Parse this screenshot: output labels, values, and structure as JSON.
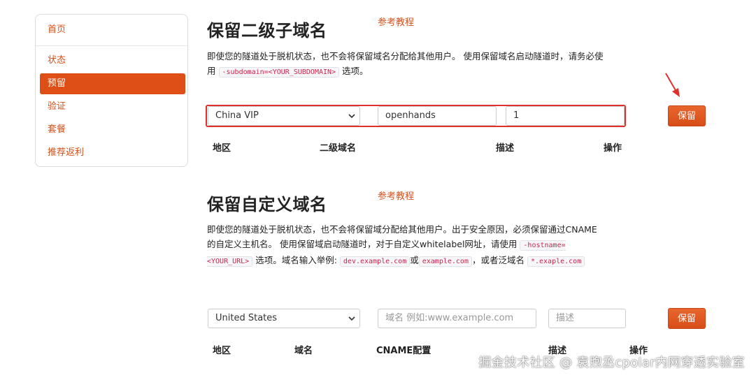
{
  "sidebar": {
    "items": [
      {
        "label": "首页",
        "active": false
      },
      {
        "label": "状态",
        "active": false
      },
      {
        "label": "预留",
        "active": true
      },
      {
        "label": "验证",
        "active": false
      },
      {
        "label": "套餐",
        "active": false
      },
      {
        "label": "推荐返利",
        "active": false
      }
    ]
  },
  "subdomain_section": {
    "title": "保留二级子域名",
    "tutorial_link": "参考教程",
    "desc_part1": "即使您的隧道处于脱机状态，也不会将保留域名分配给其他用户。 使用保留域名启动隧道时，请务必使用",
    "code_flag": "-subdomain=<YOUR_SUBDOMAIN>",
    "desc_part2": "选项。",
    "region_select_value": "China VIP",
    "subdomain_input_value": "openhands",
    "description_input_value": "1",
    "save_button": "保留",
    "table_headers": [
      "地区",
      "二级域名",
      "描述",
      "操作"
    ]
  },
  "custom_domain_section": {
    "title": "保留自定义域名",
    "tutorial_link": "参考教程",
    "desc_part1": "即使您的隧道处于脱机状态，也不会将保留域分配给其他用户。出于安全原因，必须保留通过CNAME的自定义主机名。 使用保留域启动隧道时，对于自定义whitelabel网址，请使用",
    "code_flag": "-hostname=<YOUR_URL>",
    "desc_part2": "选项。域名输入举例:",
    "code_example1": "dev.example.com",
    "desc_or": "或",
    "code_example2": "example.com",
    "desc_part3": "，或者泛域名",
    "code_example3": "*.exaple.com",
    "region_select_value": "United States",
    "domain_input_placeholder": "域名 例如:www.example.com",
    "description_input_placeholder": "描述",
    "save_button": "保留",
    "table_headers": [
      "地区",
      "域名",
      "CNAME配置",
      "描述",
      "操作"
    ]
  },
  "watermark": "掘金技术社区 @ 袁煦丞cpolar内网穿透实验室",
  "colors": {
    "accent": "#dd4f17",
    "highlight_outline": "#e0302c"
  },
  "icons": {
    "select_chevron": "chevron-down-icon",
    "annotation_arrow": "red-arrow-icon"
  }
}
